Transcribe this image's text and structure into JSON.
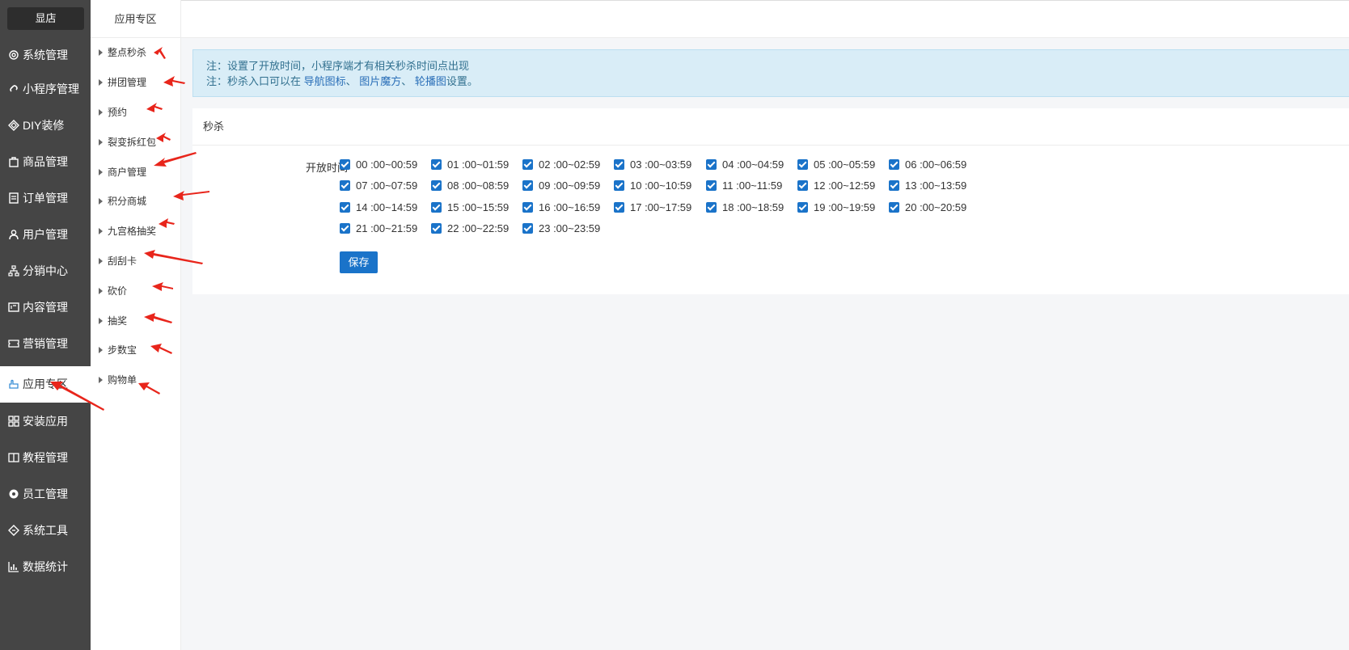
{
  "sidebar": {
    "brand": "显店",
    "items": [
      {
        "label": "系统管理",
        "icon": "gear-icon"
      },
      {
        "label": "小程序管理",
        "icon": "link-icon"
      },
      {
        "label": "DIY装修",
        "icon": "diamond-icon"
      },
      {
        "label": "商品管理",
        "icon": "bag-icon"
      },
      {
        "label": "订单管理",
        "icon": "list-icon"
      },
      {
        "label": "用户管理",
        "icon": "user-icon"
      },
      {
        "label": "分销中心",
        "icon": "hierarchy-icon"
      },
      {
        "label": "内容管理",
        "icon": "content-icon"
      },
      {
        "label": "营销管理",
        "icon": "ticket-icon"
      },
      {
        "label": "应用专区",
        "icon": "hand-icon"
      },
      {
        "label": "安装应用",
        "icon": "grid-icon"
      },
      {
        "label": "教程管理",
        "icon": "book-icon"
      },
      {
        "label": "员工管理",
        "icon": "cog-icon"
      },
      {
        "label": "系统工具",
        "icon": "tool-icon"
      },
      {
        "label": "数据统计",
        "icon": "bar-chart-icon"
      }
    ],
    "active_label": "应用专区"
  },
  "subnav": {
    "title": "应用专区",
    "items": [
      "整点秒杀",
      "拼团管理",
      "预约",
      "裂变拆红包",
      "商户管理",
      "积分商城",
      "九宫格抽奖",
      "刮刮卡",
      "砍价",
      "抽奖",
      "步数宝",
      "购物单"
    ]
  },
  "notice": {
    "line1": "注：设置了开放时间，小程序端才有相关秒杀时间点出现",
    "line2_prefix": "注：秒杀入口可以在 ",
    "link1": "导航图标",
    "sep1": "、 ",
    "link2": "图片魔方",
    "sep2": "、 ",
    "link3": "轮播图",
    "line2_suffix": "设置。"
  },
  "panel": {
    "title": "秒杀",
    "label": "开放时间",
    "slots": [
      "00 :00~00:59",
      "01 :00~01:59",
      "02 :00~02:59",
      "03 :00~03:59",
      "04 :00~04:59",
      "05 :00~05:59",
      "06 :00~06:59",
      "07 :00~07:59",
      "08 :00~08:59",
      "09 :00~09:59",
      "10 :00~10:59",
      "11 :00~11:59",
      "12 :00~12:59",
      "13 :00~13:59",
      "14 :00~14:59",
      "15 :00~15:59",
      "16 :00~16:59",
      "17 :00~17:59",
      "18 :00~18:59",
      "19 :00~19:59",
      "20 :00~20:59",
      "21 :00~21:59",
      "22 :00~22:59",
      "23 :00~23:59"
    ],
    "save_label": "保存"
  },
  "colors": {
    "sidebar_bg": "#454545",
    "accent": "#1a73c9",
    "notice_bg": "#d9edf7",
    "arrow": "#e8251b"
  }
}
